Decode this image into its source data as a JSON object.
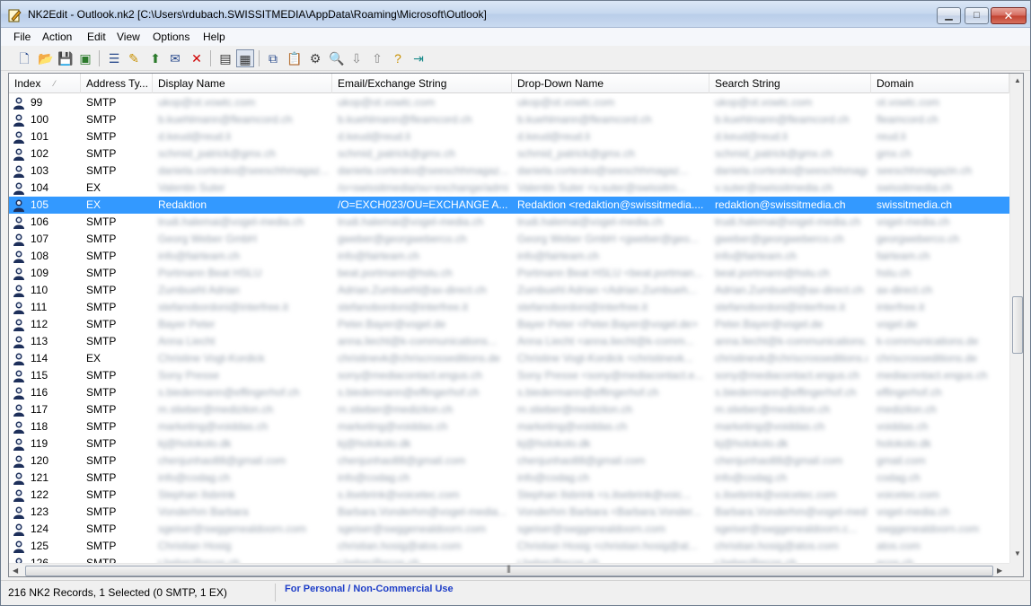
{
  "window": {
    "app_name": "NK2Edit",
    "title": "NK2Edit -   Outlook.nk2   [C:\\Users\\rdubach.SWISSITMEDIA\\AppData\\Roaming\\Microsoft\\Outlook]"
  },
  "menu": [
    {
      "label": "File"
    },
    {
      "label": "Action"
    },
    {
      "label": "Edit"
    },
    {
      "label": "View"
    },
    {
      "label": "Options"
    },
    {
      "label": "Help"
    }
  ],
  "toolbar": [
    {
      "icon": "new-file-icon"
    },
    {
      "icon": "open-folder-icon"
    },
    {
      "icon": "save-icon"
    },
    {
      "icon": "save-as-icon"
    },
    {
      "icon": "properties-icon"
    },
    {
      "icon": "add-address-icon"
    },
    {
      "icon": "add-from-book-icon"
    },
    {
      "icon": "edit-address-icon"
    },
    {
      "icon": "delete-icon"
    },
    {
      "icon": "view-list-icon"
    },
    {
      "icon": "view-table-icon"
    },
    {
      "icon": "copy-icon"
    },
    {
      "icon": "paste-icon"
    },
    {
      "icon": "options-icon"
    },
    {
      "icon": "find-icon"
    },
    {
      "icon": "move-down-icon"
    },
    {
      "icon": "move-up-icon"
    },
    {
      "icon": "help-icon"
    },
    {
      "icon": "exit-icon"
    }
  ],
  "columns": [
    {
      "label": "Index"
    },
    {
      "label": "Address Ty..."
    },
    {
      "label": "Display Name"
    },
    {
      "label": "Email/Exchange String"
    },
    {
      "label": "Drop-Down Name"
    },
    {
      "label": "Search String"
    },
    {
      "label": "Domain"
    }
  ],
  "rows": [
    {
      "index": "99",
      "type": "SMTP",
      "display": "ukop@ot.vowtc.com",
      "email": "ukop@ot.vowtc.com",
      "dropdown": "ukop@ot.vowtc.com",
      "search": "ukop@ot.vowtc.com",
      "domain": "ot.vowtc.com",
      "selected": false
    },
    {
      "index": "100",
      "type": "SMTP",
      "display": "b.kuehlmann@fleamcord.ch",
      "email": "b.kuehlmann@fleamcord.ch",
      "dropdown": "b.kuehlmann@fleamcord.ch",
      "search": "b.kuehlmann@fleamcord.ch",
      "domain": "fleamcord.ch",
      "selected": false
    },
    {
      "index": "101",
      "type": "SMTP",
      "display": "d.keud@reud.li",
      "email": "d.keud@reud.li",
      "dropdown": "d.keud@reud.li",
      "search": "d.keud@reud.li",
      "domain": "reud.li",
      "selected": false
    },
    {
      "index": "102",
      "type": "SMTP",
      "display": "schmid_patrick@gmx.ch",
      "email": "schmid_patrick@gmx.ch",
      "dropdown": "schmid_patrick@gmx.ch",
      "search": "schmid_patrick@gmx.ch",
      "domain": "gmx.ch",
      "selected": false
    },
    {
      "index": "103",
      "type": "SMTP",
      "display": "daniela.cortesko@seeschhmagaz...",
      "email": "daniela.cortesko@seeschhmagaz...",
      "dropdown": "daniela.cortesko@seeschhmagaz...",
      "search": "daniela.cortesko@seeschhmagaz...",
      "domain": "seeschhmagazin.ch",
      "selected": false
    },
    {
      "index": "104",
      "type": "EX",
      "display": "Valentin Suter",
      "email": "/o=swissitmedia/ou=exchange/admin...",
      "dropdown": "Valentin Suter <v.suter@swissitm...",
      "search": "v.suter@swissitmedia.ch",
      "domain": "swissitmedia.ch",
      "selected": false
    },
    {
      "index": "105",
      "type": "EX",
      "display": "Redaktion",
      "email": "/O=EXCH023/OU=EXCHANGE A...",
      "dropdown": "Redaktion  <redaktion@swissitmedia....",
      "search": "redaktion@swissitmedia.ch",
      "domain": "swissitmedia.ch",
      "selected": true
    },
    {
      "index": "106",
      "type": "SMTP",
      "display": "trudi.halemai@vogel-media.ch",
      "email": "trudi.halemai@vogel-media.ch",
      "dropdown": "trudi.halemai@vogel-media.ch",
      "search": "trudi.halemai@vogel-media.ch",
      "domain": "vogel-media.ch",
      "selected": false
    },
    {
      "index": "107",
      "type": "SMTP",
      "display": "Georg Weber GmbH",
      "email": "gweber@georgweberco.ch",
      "dropdown": "Georg Weber GmbH <gweber@geo...",
      "search": "gweber@georgweberco.ch",
      "domain": "georgweberco.ch",
      "selected": false
    },
    {
      "index": "108",
      "type": "SMTP",
      "display": "info@fairteam.ch",
      "email": "info@fairteam.ch",
      "dropdown": "info@fairteam.ch",
      "search": "info@fairteam.ch",
      "domain": "fairteam.ch",
      "selected": false
    },
    {
      "index": "109",
      "type": "SMTP",
      "display": "Portmann Beat HSLU",
      "email": "beat.portmann@hslu.ch",
      "dropdown": "Portmann Beat HSLU <beat.portman...",
      "search": "beat.portmann@hslu.ch",
      "domain": "hslu.ch",
      "selected": false
    },
    {
      "index": "110",
      "type": "SMTP",
      "display": "Zumbuehl Adrian",
      "email": "Adrian.Zumbuehl@ax-direct.ch",
      "dropdown": "Zumbuehl Adrian <Adrian.Zumbueh...",
      "search": "Adrian.Zumbuehl@ax-direct.ch",
      "domain": "ax-direct.ch",
      "selected": false
    },
    {
      "index": "111",
      "type": "SMTP",
      "display": "stefanobordoni@interfree.it",
      "email": "stefanobordoni@interfree.it",
      "dropdown": "stefanobordoni@interfree.it",
      "search": "stefanobordoni@interfree.it",
      "domain": "interfree.it",
      "selected": false
    },
    {
      "index": "112",
      "type": "SMTP",
      "display": "Bayer Peter",
      "email": "Peter.Bayer@vogel.de",
      "dropdown": "Bayer Peter <Peter.Bayer@vogel.de>",
      "search": "Peter.Bayer@vogel.de",
      "domain": "vogel.de",
      "selected": false
    },
    {
      "index": "113",
      "type": "SMTP",
      "display": "Anna Liecht",
      "email": "anna.liecht@k-communications...",
      "dropdown": "Anna Liecht <anna.liecht@k-comm...",
      "search": "anna.liecht@k-communications.de",
      "domain": "k-communications.de",
      "selected": false
    },
    {
      "index": "114",
      "type": "EX",
      "display": "Christine Vogt-Kordick",
      "email": "christinevk@chriscrosseditions.de",
      "dropdown": "Christine Vogt-Kordick <christinevk...",
      "search": "christinevk@chriscrosseditions.de",
      "domain": "chriscrosseditions.de",
      "selected": false
    },
    {
      "index": "115",
      "type": "SMTP",
      "display": "Sony Presse",
      "email": "sony@mediacontact.engus.ch",
      "dropdown": "Sony Presse <sony@mediacontact.e...",
      "search": "sony@mediacontact.engus.ch",
      "domain": "mediacontact.engus.ch",
      "selected": false
    },
    {
      "index": "116",
      "type": "SMTP",
      "display": "s.biedermann@effingerhof.ch",
      "email": "s.biedermann@effingerhof.ch",
      "dropdown": "s.biedermann@effingerhof.ch",
      "search": "s.biedermann@effingerhof.ch",
      "domain": "effingerhof.ch",
      "selected": false
    },
    {
      "index": "117",
      "type": "SMTP",
      "display": "m.stieber@medizilon.ch",
      "email": "m.stieber@medizilon.ch",
      "dropdown": "m.stieber@medizilon.ch",
      "search": "m.stieber@medizilon.ch",
      "domain": "medizilon.ch",
      "selected": false
    },
    {
      "index": "118",
      "type": "SMTP",
      "display": "marketing@voiddas.ch",
      "email": "marketing@voiddas.ch",
      "dropdown": "marketing@voiddas.ch",
      "search": "marketing@voiddas.ch",
      "domain": "voiddas.ch",
      "selected": false
    },
    {
      "index": "119",
      "type": "SMTP",
      "display": "kj@holokolo.dk",
      "email": "kj@holokolo.dk",
      "dropdown": "kj@holokolo.dk",
      "search": "kj@holokolo.dk",
      "domain": "holokolo.dk",
      "selected": false
    },
    {
      "index": "120",
      "type": "SMTP",
      "display": "chenjunhao88@gmail.com",
      "email": "chenjunhao88@gmail.com",
      "dropdown": "chenjunhao88@gmail.com",
      "search": "chenjunhao88@gmail.com",
      "domain": "gmail.com",
      "selected": false
    },
    {
      "index": "121",
      "type": "SMTP",
      "display": "info@codag.ch",
      "email": "info@codag.ch",
      "dropdown": "info@codag.ch",
      "search": "info@codag.ch",
      "domain": "codag.ch",
      "selected": false
    },
    {
      "index": "122",
      "type": "SMTP",
      "display": "Stephan Ilsbrink",
      "email": "s.ilsebrink@voicetec.com",
      "dropdown": "Stephan Ilsbrink <s.ilsebrink@voic...",
      "search": "s.ilsebrink@voicetec.com",
      "domain": "voicetec.com",
      "selected": false
    },
    {
      "index": "123",
      "type": "SMTP",
      "display": "Vonderhm Barbara",
      "email": "Barbara.Vonderhm@vogel-media...",
      "dropdown": "Vonderhm Barbara <Barbara.Vonder...",
      "search": "Barbara.Vonderhm@vogel-media.ch",
      "domain": "vogel-media.ch",
      "selected": false
    },
    {
      "index": "124",
      "type": "SMTP",
      "display": "sgeiser@swggenealdoorn.com",
      "email": "sgeiser@swggenealdoorn.com",
      "dropdown": "sgeiser@swggenealdoorn.com",
      "search": "sgeiser@swggenealdoorn.c...",
      "domain": "swggenealdoorn.com",
      "selected": false
    },
    {
      "index": "125",
      "type": "SMTP",
      "display": "Christian Hosig",
      "email": "christian.hosig@atos.com",
      "dropdown": "Christian Hosig <christian.hosig@at...",
      "search": "christian.hosig@atos.com",
      "domain": "atos.com",
      "selected": false
    },
    {
      "index": "126",
      "type": "SMTP",
      "display": "r.heber@ecos.ch",
      "email": "r.heber@ecos.ch",
      "dropdown": "r.heber@ecos.ch",
      "search": "r.heber@ecos.ch",
      "domain": "ecos.ch",
      "selected": false
    }
  ],
  "status": {
    "records": "216 NK2 Records, 1 Selected  (0 SMTP,  1 EX)",
    "license": "For Personal / Non-Commercial Use"
  },
  "colors": {
    "selection": "#3399ff",
    "license_text": "#1f3fc8"
  }
}
